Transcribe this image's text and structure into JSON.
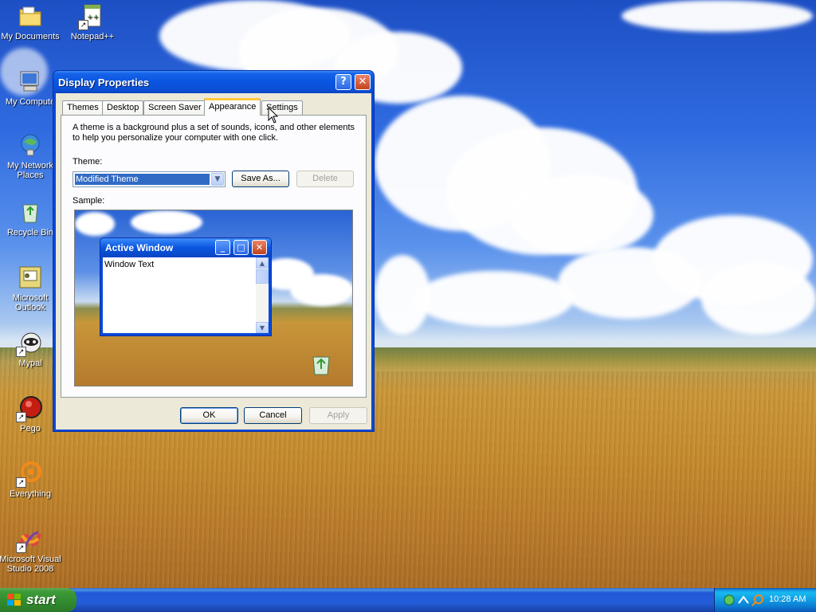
{
  "desktop": {
    "icons": [
      {
        "label": "My Documents",
        "icon": "my-documents-icon",
        "shortcut": false
      },
      {
        "label": "Notepad++",
        "icon": "notepad-plus-plus-icon",
        "shortcut": true
      },
      {
        "label": "My Compute",
        "icon": "my-computer-icon",
        "shortcut": false
      },
      {
        "label": "My Network\nPlaces",
        "icon": "network-places-icon",
        "shortcut": false
      },
      {
        "label": "Recycle Bin",
        "icon": "recycle-bin-icon",
        "shortcut": false
      },
      {
        "label": "Microsoft\nOutlook",
        "icon": "outlook-icon",
        "shortcut": false
      },
      {
        "label": "Mypal",
        "icon": "mypal-icon",
        "shortcut": true
      },
      {
        "label": "Pego",
        "icon": "pego-icon",
        "shortcut": true
      },
      {
        "label": "Everything",
        "icon": "everything-icon",
        "shortcut": true
      },
      {
        "label": "Microsoft Visual\nStudio 2008",
        "icon": "visual-studio-icon",
        "shortcut": true
      }
    ]
  },
  "window": {
    "title": "Display Properties",
    "help_glyph": "?",
    "close_glyph": "✕",
    "tabs": [
      {
        "label": "Themes",
        "active": false
      },
      {
        "label": "Desktop",
        "active": false
      },
      {
        "label": "Screen Saver",
        "active": false
      },
      {
        "label": "Appearance",
        "active": true
      },
      {
        "label": "Settings",
        "active": false
      }
    ],
    "description": "A theme is a background plus a set of sounds, icons, and other elements to help you personalize your computer with one click.",
    "theme_label": "Theme:",
    "theme_value": "Modified Theme",
    "save_as_label": "Save As...",
    "delete_label": "Delete",
    "sample_label": "Sample:",
    "sample": {
      "window_title": "Active Window",
      "window_text": "Window Text"
    },
    "ok_label": "OK",
    "cancel_label": "Cancel",
    "apply_label": "Apply"
  },
  "taskbar": {
    "start_label": "start",
    "clock": "10:28 AM"
  },
  "colors": {
    "titlebar": "#0a55e0",
    "selection": "#316ac5",
    "start_green": "#3c9b37",
    "taskbar_blue": "#245edb"
  }
}
